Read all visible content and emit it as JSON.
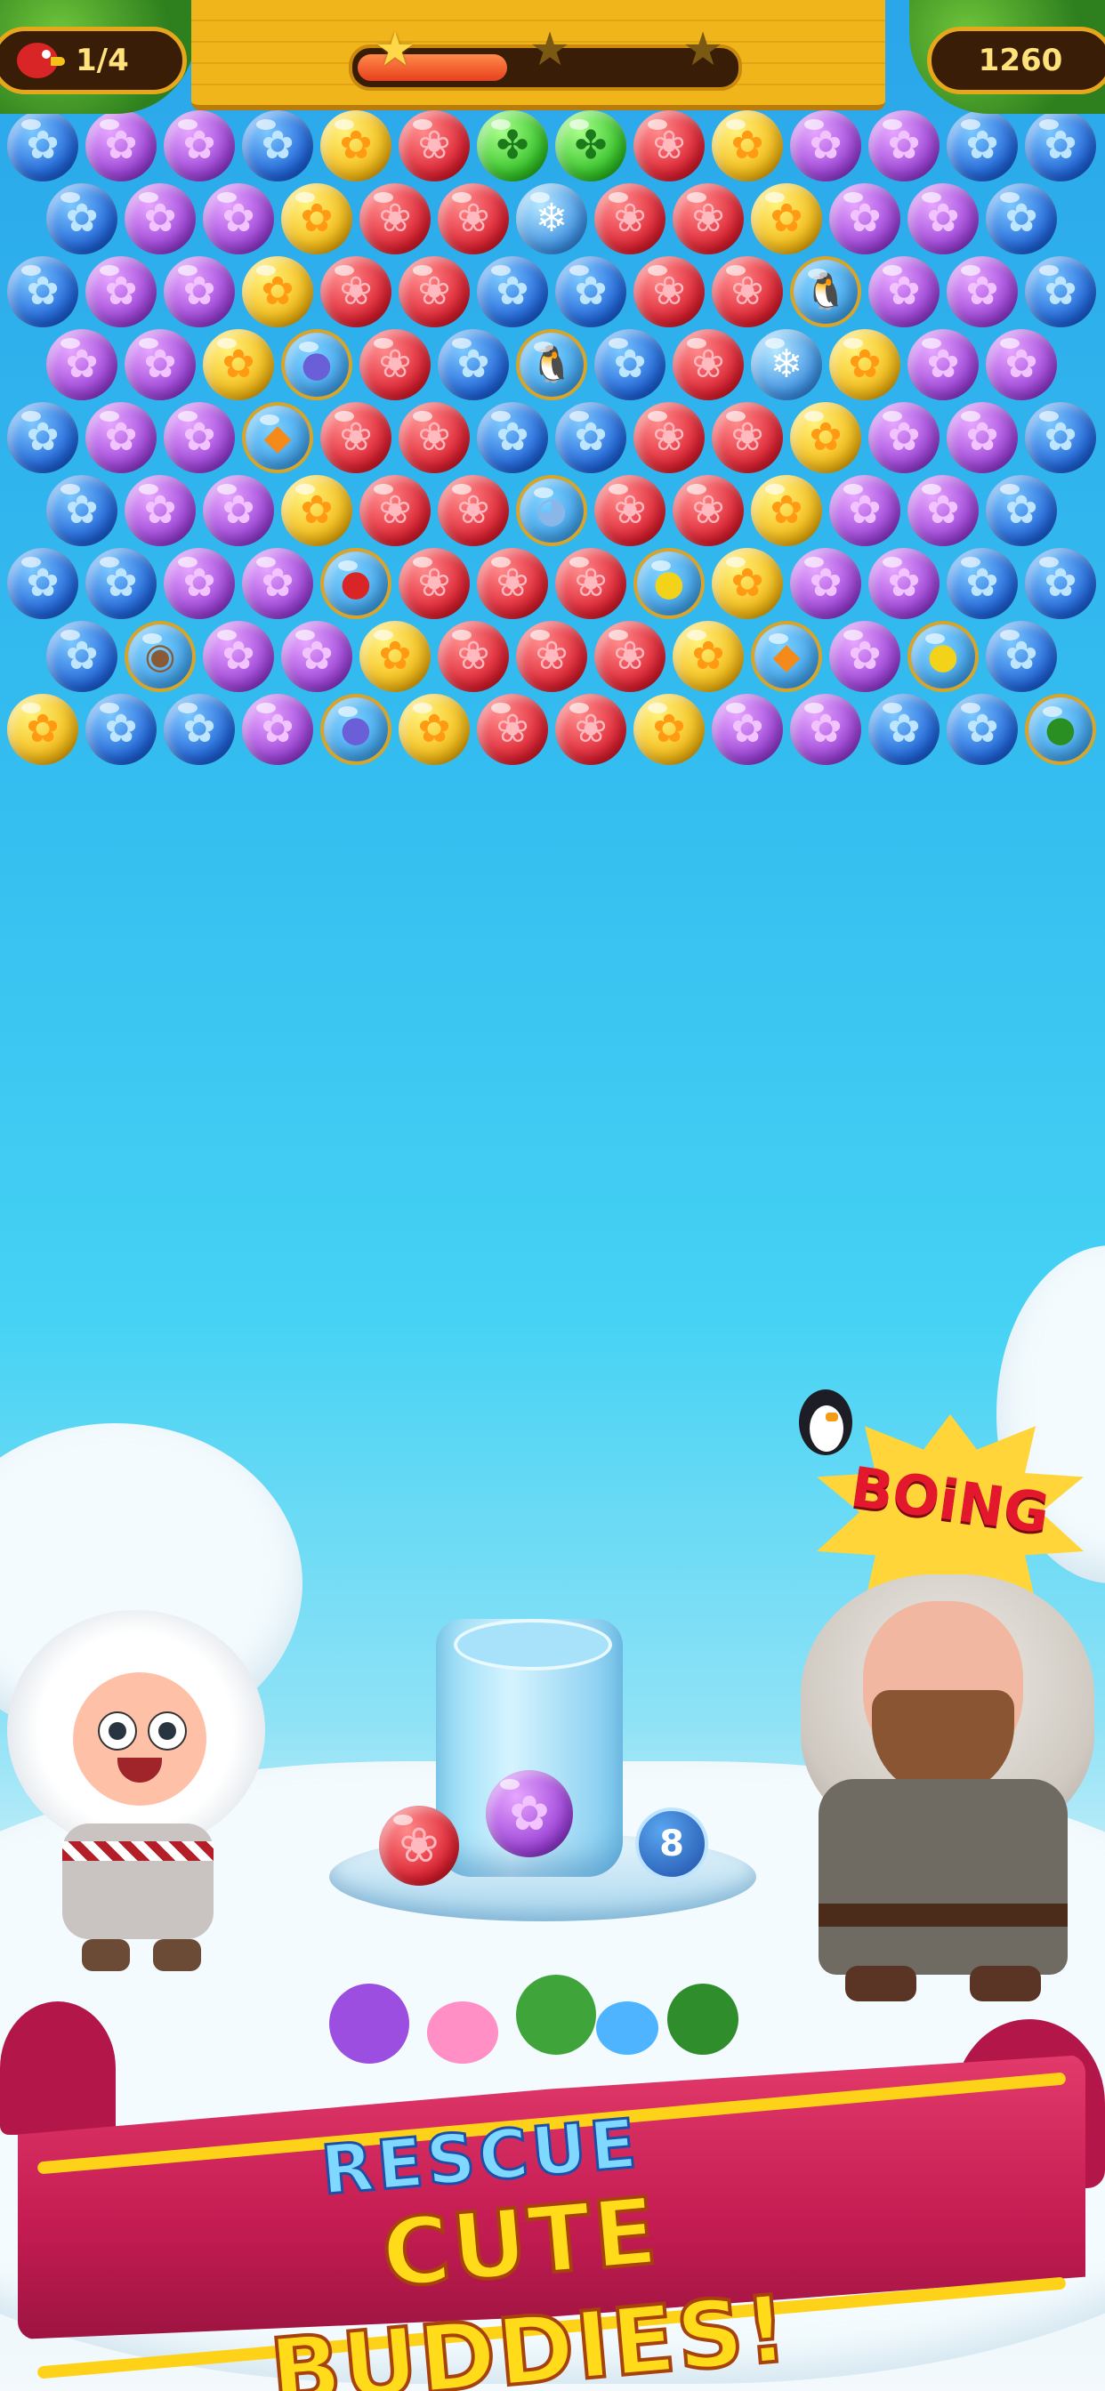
{
  "hud": {
    "goal": "1/4",
    "score": "1260",
    "progress_fraction": 0.4,
    "stars_earned": 1,
    "stars_total": 3
  },
  "board": {
    "rows": [
      "BPPBYRGGRYPPBB",
      "BPPYRRIRRYPPB",
      "BPPYRRBBRRNPPB",
      "PPYSRBNBRIYPP",
      "BPPFRRBBRRYPPB",
      "BPPYRRKRRYPPB",
      "BBPPARRRDYPPBB",
      "BMPPYRRRYFPDB",
      "YBBPSYRRYPPBBL"
    ],
    "colors": {
      "blue": "#1e62d8",
      "purple": "#9a3fd6",
      "red": "#dc1e2e",
      "yellow": "#f3b712",
      "green": "#2fbf24"
    }
  },
  "launcher": {
    "current_bubble": "purple",
    "next_bubble": "red",
    "shots_left": "8"
  },
  "scene": {
    "boing_text": "BOiNG"
  },
  "banner": {
    "line1": "RESCUE",
    "line2": "CUTE BUDDIES!"
  }
}
